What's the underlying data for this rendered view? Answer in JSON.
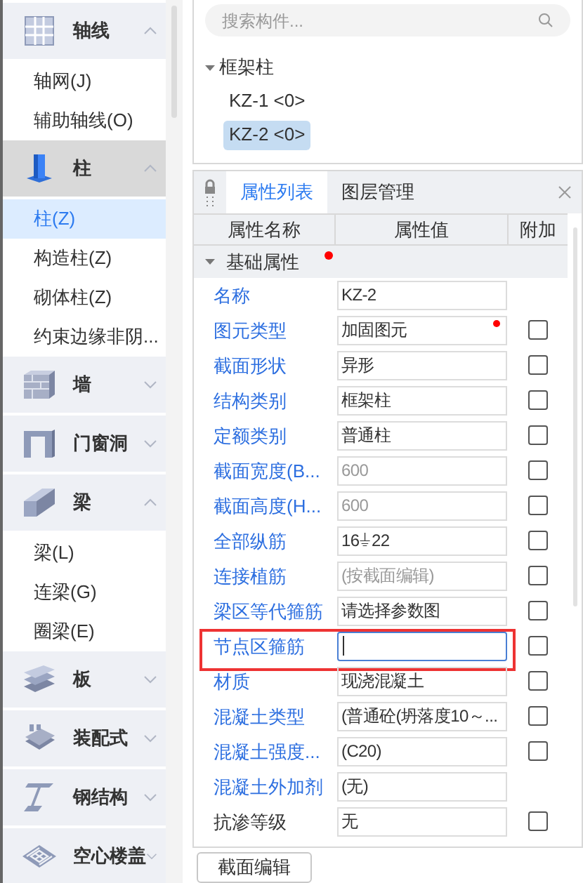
{
  "sidebar": {
    "sections": [
      {
        "kind": "grid",
        "label": "轴线",
        "expanded": true,
        "selected": false,
        "items": [
          {
            "label": "轴网(J)",
            "selected": false
          },
          {
            "label": "辅助轴线(O)",
            "selected": false
          }
        ]
      },
      {
        "kind": "column",
        "label": "柱",
        "expanded": true,
        "selected": true,
        "items": [
          {
            "label": "柱(Z)",
            "selected": true
          },
          {
            "label": "构造柱(Z)",
            "selected": false
          },
          {
            "label": "砌体柱(Z)",
            "selected": false
          },
          {
            "label": "约束边缘非阴...",
            "selected": false
          }
        ]
      },
      {
        "kind": "wall",
        "label": "墙",
        "expanded": false,
        "selected": false
      },
      {
        "kind": "opening",
        "label": "门窗洞",
        "expanded": false,
        "selected": false
      },
      {
        "kind": "beam",
        "label": "梁",
        "expanded": true,
        "selected": false,
        "items": [
          {
            "label": "梁(L)",
            "selected": false
          },
          {
            "label": "连梁(G)",
            "selected": false
          },
          {
            "label": "圈梁(E)",
            "selected": false
          }
        ]
      },
      {
        "kind": "slab",
        "label": "板",
        "expanded": false,
        "selected": false
      },
      {
        "kind": "prefab",
        "label": "装配式",
        "expanded": false,
        "selected": false
      },
      {
        "kind": "steel",
        "label": "钢结构",
        "expanded": false,
        "selected": false
      },
      {
        "kind": "hollow",
        "label": "空心楼盖",
        "expanded": false,
        "selected": false
      }
    ]
  },
  "component_tree": {
    "search": {
      "placeholder": "搜索构件..."
    },
    "groups": [
      {
        "label": "框架柱",
        "expanded": true,
        "children": [
          {
            "label": "KZ-1 <0>",
            "selected": false
          },
          {
            "label": "KZ-2 <0>",
            "selected": true
          }
        ]
      }
    ]
  },
  "properties": {
    "tabs": [
      {
        "label": "属性列表",
        "selected": true
      },
      {
        "label": "图层管理",
        "selected": false
      }
    ],
    "columns": [
      "属性名称",
      "属性值",
      "附加"
    ],
    "group": {
      "label": "基础属性",
      "expanded": true,
      "modified": true
    },
    "rows": [
      {
        "name": "名称",
        "value": "KZ-2",
        "linked": true,
        "disabled": false
      },
      {
        "name": "图元类型",
        "value": "加固图元",
        "linked": true,
        "disabled": false,
        "modified": true,
        "checked": false
      },
      {
        "name": "截面形状",
        "value": "异形",
        "linked": true,
        "disabled": false,
        "checked": false
      },
      {
        "name": "结构类别",
        "value": "框架柱",
        "linked": true,
        "disabled": false,
        "checked": false
      },
      {
        "name": "定额类别",
        "value": "普通柱",
        "linked": true,
        "disabled": false,
        "checked": false
      },
      {
        "name": "截面宽度(B...",
        "value": "600",
        "linked": true,
        "disabled": true,
        "checked": false
      },
      {
        "name": "截面高度(H...",
        "value": "600",
        "linked": true,
        "disabled": true,
        "checked": false
      },
      {
        "name": "全部纵筋",
        "value": "16⏚22",
        "linked": true,
        "disabled": false,
        "checked": false
      },
      {
        "name": "连接植筋",
        "value": "(按截面编辑)",
        "linked": true,
        "disabled": true,
        "checked": false
      },
      {
        "name": "梁区等代箍筋",
        "value": "请选择参数图",
        "linked": true,
        "disabled": false,
        "checked": false
      },
      {
        "name": "节点区箍筋",
        "value": "",
        "linked": true,
        "disabled": false,
        "focused": true,
        "highlighted": true,
        "checked": false
      },
      {
        "name": "材质",
        "value": "现浇混凝土",
        "linked": true,
        "disabled": false,
        "checked": false
      },
      {
        "name": "混凝土类型",
        "value": "(普通砼(坍落度10～...",
        "linked": true,
        "disabled": false,
        "checked": false
      },
      {
        "name": "混凝土强度...",
        "value": "(C20)",
        "linked": true,
        "disabled": false,
        "checked": false
      },
      {
        "name": "混凝土外加剂",
        "value": "(无)",
        "linked": true,
        "disabled": false
      },
      {
        "name": "抗渗等级",
        "value": "无",
        "linked": false,
        "disabled": false,
        "checked": false
      }
    ]
  },
  "buttons": [
    "截面编辑"
  ]
}
